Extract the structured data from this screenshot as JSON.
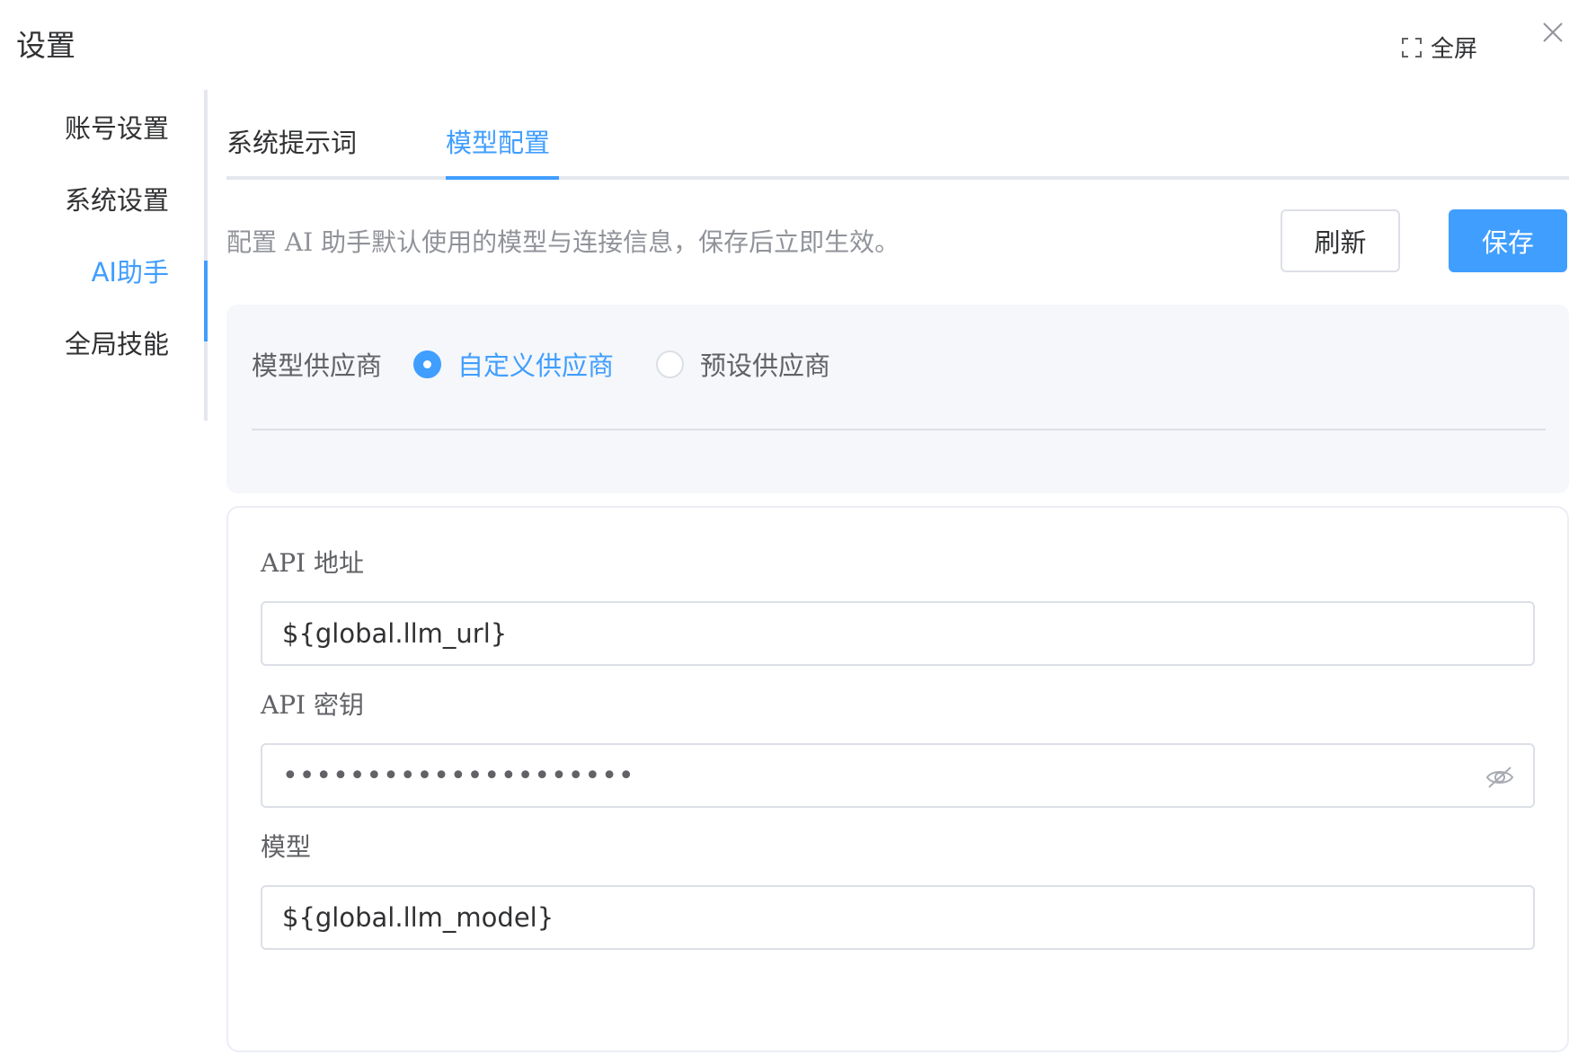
{
  "dialog": {
    "title": "设置",
    "fullscreen_label": "全屏"
  },
  "sidebar": {
    "items": [
      {
        "label": "账号设置"
      },
      {
        "label": "系统设置"
      },
      {
        "label": "AI助手",
        "active": true
      },
      {
        "label": "全局技能"
      }
    ]
  },
  "tabs": [
    {
      "label": "系统提示词"
    },
    {
      "label": "模型配置",
      "active": true
    }
  ],
  "description": "配置 AI 助手默认使用的模型与连接信息，保存后立即生效。",
  "actions": {
    "refresh_label": "刷新",
    "save_label": "保存"
  },
  "provider": {
    "label": "模型供应商",
    "options": [
      {
        "label": "自定义供应商",
        "checked": true
      },
      {
        "label": "预设供应商",
        "checked": false
      }
    ]
  },
  "form": {
    "api_url": {
      "label": "API 地址",
      "value": "${global.llm_url}"
    },
    "api_key": {
      "label": "API 密钥",
      "value": "•••••••••••••••••••••"
    },
    "model": {
      "label": "模型",
      "value": "${global.llm_model}"
    }
  },
  "colors": {
    "accent": "#409eff",
    "text": "#303133",
    "muted": "#909399",
    "panel": "#f5f7fa"
  }
}
